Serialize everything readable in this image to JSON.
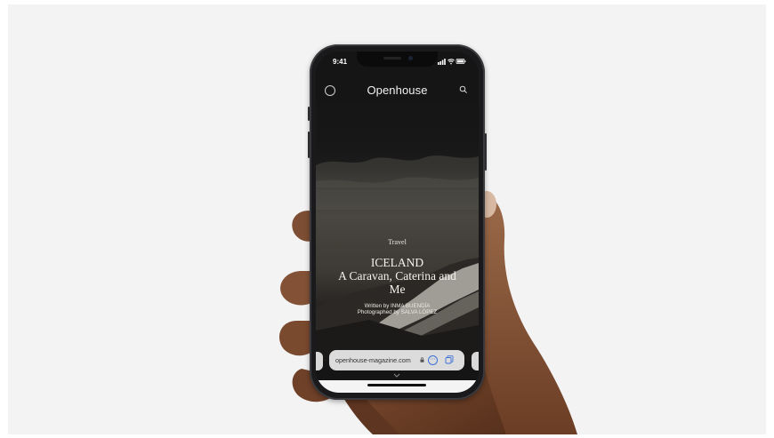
{
  "status_bar": {
    "time": "9:41"
  },
  "app": {
    "title": "Openhouse",
    "article": {
      "category": "Travel",
      "headline_line1": "ICELAND",
      "headline_line2": "A Caravan, Caterina and",
      "headline_line3": "Me",
      "written_by": "Written by INMA BUENDÍA",
      "photographed_by": "Photographed by SALVA LÓPEZ"
    }
  },
  "browser": {
    "url": "openhouse-magazine.com",
    "more_glyph": "⋯"
  },
  "colors": {
    "background": "#f3f3f3",
    "accent_blue": "#3b6fd6",
    "phone_frame": "#1a1a1c"
  }
}
